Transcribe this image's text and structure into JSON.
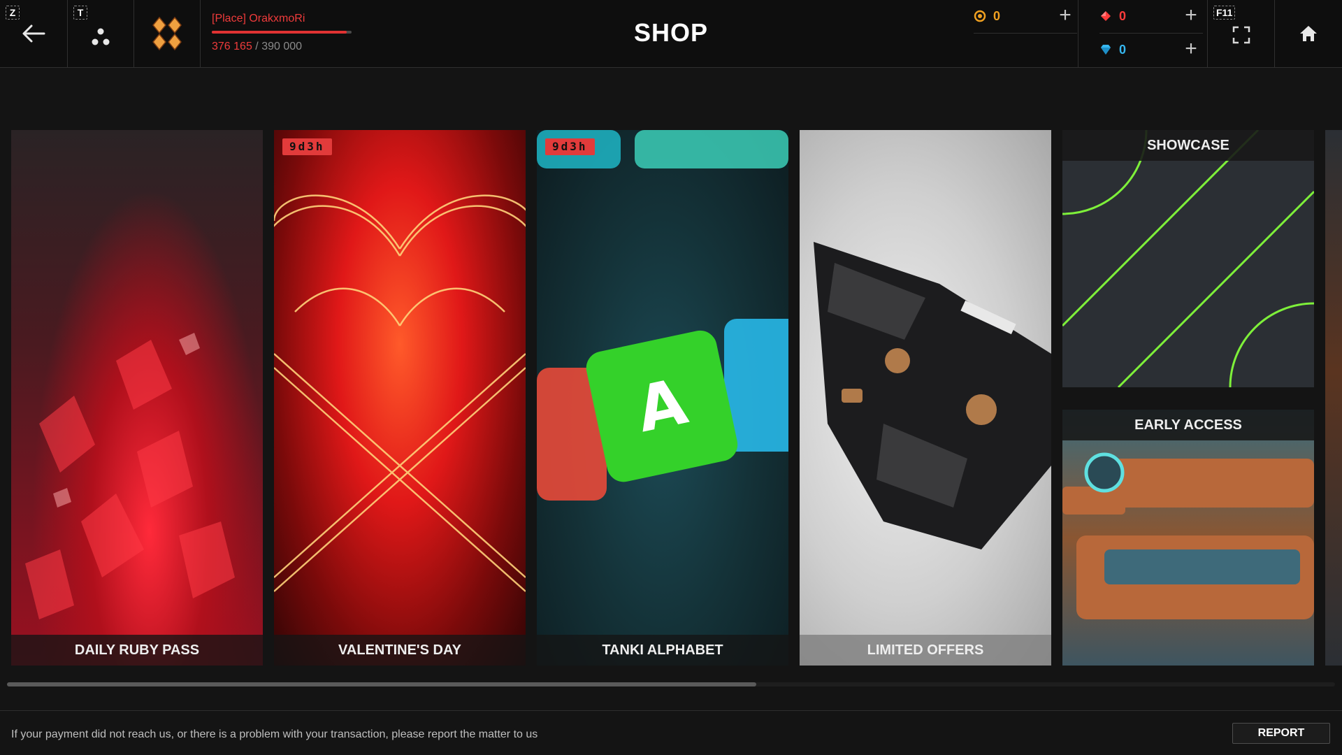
{
  "header": {
    "title": "SHOP",
    "back_hotkey": "Z",
    "clan_hotkey": "T",
    "fullscreen_hotkey": "F11",
    "player": {
      "name": "[Place] OrakxmoRi",
      "xp_current": "376 165",
      "xp_separator": " / ",
      "xp_max": "390 000",
      "xp_progress": 0.9645
    },
    "currencies": {
      "crystals": "0",
      "rubies": "0",
      "diamonds": "0"
    }
  },
  "cards": [
    {
      "label": "DAILY RUBY PASS",
      "timer": ""
    },
    {
      "label": "VALENTINE'S DAY",
      "timer": "9d3h"
    },
    {
      "label": "TANKI ALPHABET",
      "timer": "9d3h"
    },
    {
      "label": "LIMITED OFFERS",
      "timer": ""
    }
  ],
  "side_cards": {
    "showcase": "SHOWCASE",
    "early_access": "EARLY ACCESS"
  },
  "footer": {
    "message": "If your payment did not reach us, or there is a problem with your transaction, please report the matter to us",
    "report_label": "REPORT"
  },
  "colors": {
    "accent_red": "#e23b3b",
    "crystal": "#f0a020",
    "ruby": "#ff3b3b",
    "diamond": "#36b7f0",
    "showcase_line": "#7ef03a"
  }
}
